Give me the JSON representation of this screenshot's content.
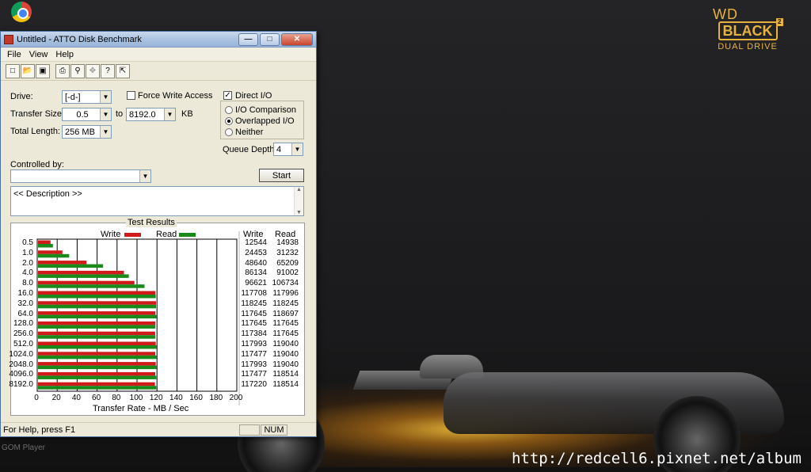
{
  "desktop": {
    "brand_top": "WD",
    "brand_main": "BLACK",
    "brand_sup": "2",
    "brand_sub": "DUAL DRIVE",
    "icon_label": "GOM Player",
    "watermark": "http://redcell6.pixnet.net/album"
  },
  "window": {
    "title": "Untitled - ATTO Disk Benchmark",
    "menu": [
      "File",
      "View",
      "Help"
    ],
    "toolbar_icons": [
      "new-icon",
      "open-icon",
      "save-icon",
      "print-icon",
      "print-preview-icon",
      "move-icon",
      "help-icon",
      "context-help-icon"
    ],
    "drive_label": "Drive:",
    "drive_value": "[-d-]",
    "force_write_label": "Force Write Access",
    "direct_io_label": "Direct I/O",
    "direct_io_checked": true,
    "transfer_size_label": "Transfer Size:",
    "transfer_from": "0.5",
    "to_label": "to",
    "transfer_to": "8192.0",
    "kb_label": "KB",
    "total_length_label": "Total Length:",
    "total_length_value": "256 MB",
    "io_comparison_label": "I/O Comparison",
    "overlapped_label": "Overlapped I/O",
    "neither_label": "Neither",
    "queue_depth_label": "Queue Depth:",
    "queue_depth_value": "4",
    "controlled_by_label": "Controlled by:",
    "controlled_by_value": "",
    "start_label": "Start",
    "description": "<< Description >>",
    "status_text": "For Help, press F1",
    "status_num": "NUM"
  },
  "colors": {
    "write": "#d11a1a",
    "read": "#1a8a1a"
  },
  "chart_data": {
    "type": "bar",
    "title": "Test Results",
    "xlabel": "Transfer Rate - MB / Sec",
    "xlim": [
      0,
      200
    ],
    "xticks": [
      "0",
      "20",
      "40",
      "60",
      "80",
      "100",
      "120",
      "140",
      "160",
      "180",
      "200"
    ],
    "legend": [
      "Write",
      "Read"
    ],
    "col_write": "Write",
    "col_read": "Read",
    "categories": [
      "0.5",
      "1.0",
      "2.0",
      "4.0",
      "8.0",
      "16.0",
      "32.0",
      "64.0",
      "128.0",
      "256.0",
      "512.0",
      "1024.0",
      "2048.0",
      "4096.0",
      "8192.0"
    ],
    "series": [
      {
        "name": "Write",
        "values": [
          12544,
          24453,
          48640,
          86134,
          96621,
          117708,
          118245,
          117645,
          117645,
          117384,
          117993,
          117477,
          117993,
          117477,
          117220
        ]
      },
      {
        "name": "Read",
        "values": [
          14938,
          31232,
          65209,
          91002,
          106734,
          117996,
          118245,
          118697,
          117645,
          117645,
          119040,
          119040,
          119040,
          118514,
          118514
        ]
      }
    ]
  }
}
